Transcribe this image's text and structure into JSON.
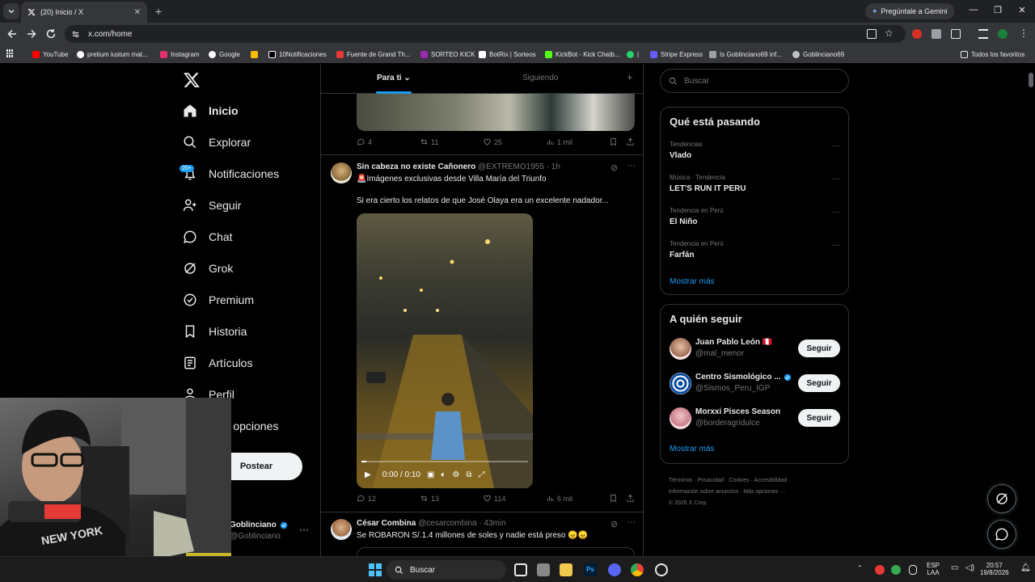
{
  "browser": {
    "tab_title": "(20) Inicio / X",
    "gemini_label": "Pregúntale a Gemini",
    "url": "x.com/home",
    "bookmarks": [
      "YouTube",
      "pretium iustum mat...",
      "Instagram",
      "Google",
      "10Notificaciones",
      "Fuente de Grand Th...",
      "SORTEO KICK",
      "BotRix | Sorteos",
      "KickBot - Kick Chatb...",
      "|",
      "Stripe Express",
      "Is Goblinciano69 inf...",
      "Goblinciano69"
    ],
    "all_bookmarks_label": "Todos los favoritos"
  },
  "nav": {
    "items": [
      "Inicio",
      "Explorar",
      "Notificaciones",
      "Seguir",
      "Chat",
      "Grok",
      "Premium",
      "Historia",
      "Artículos",
      "Perfil",
      "Más opciones"
    ],
    "notif_badge": "20+",
    "post_label": "Postear",
    "profile_name": "Goblinciano",
    "profile_handle": "@Goblinciano"
  },
  "feed": {
    "tabs": [
      "Para ti",
      "Siguiendo"
    ],
    "post1_stats": {
      "replies": "4",
      "reposts": "11",
      "likes": "25",
      "views": "1 mil"
    },
    "post2": {
      "author": "Sin cabeza no existe Cañonero",
      "handle": "@EXTREMO1955",
      "time": "· 1h",
      "line1": "🚨Imágenes exclusivas desde Villa María del Triunfo",
      "line2": "Si era cierto los relatos de que José Olaya era un excelente nadador...",
      "video_time": "0:00 / 0:10",
      "stats": {
        "replies": "12",
        "reposts": "13",
        "likes": "114",
        "views": "6 mil"
      }
    },
    "post3": {
      "author": "César Combina",
      "handle": "@cesarcombina",
      "time": "· 43min",
      "text": "Se ROBARON S/.1.4 millones de soles y nadie está preso 😠😠"
    }
  },
  "sidebar": {
    "search_placeholder": "Buscar",
    "trends_title": "Qué está pasando",
    "trends": [
      {
        "meta": "Tendencias",
        "name": "Vlado"
      },
      {
        "meta": "Música · Tendencia",
        "name": "LET'S RUN IT PERU"
      },
      {
        "meta": "Tendencia en Perú",
        "name": "El Niño"
      },
      {
        "meta": "Tendencia en Perú",
        "name": "Farfán"
      }
    ],
    "show_more": "Mostrar más",
    "wtf_title": "A quién seguir",
    "who_to_follow": [
      {
        "name": "Juan Pablo León 🇵🇪",
        "handle": "@mal_menor"
      },
      {
        "name": "Centro Sismológico ...",
        "handle": "@Sismos_Peru_IGP"
      },
      {
        "name": "Morxxi Pisces Season",
        "handle": "@borderagridulce"
      }
    ],
    "follow_label": "Seguir",
    "footer_line1": "Términos · Privacidad · Cookies · Accesibilidad ·",
    "footer_line2": "Información sobre anuncios · Más opciones ···",
    "footer_line3": "© 2026 X Corp."
  },
  "taskbar": {
    "search": "Buscar",
    "lang1": "ESP",
    "lang2": "LAA",
    "time": "20:57",
    "date": "19/8/2026"
  },
  "colors": {
    "accent": "#1d9bf0",
    "background": "#000000",
    "border": "#2f3336",
    "muted": "#71767b"
  }
}
